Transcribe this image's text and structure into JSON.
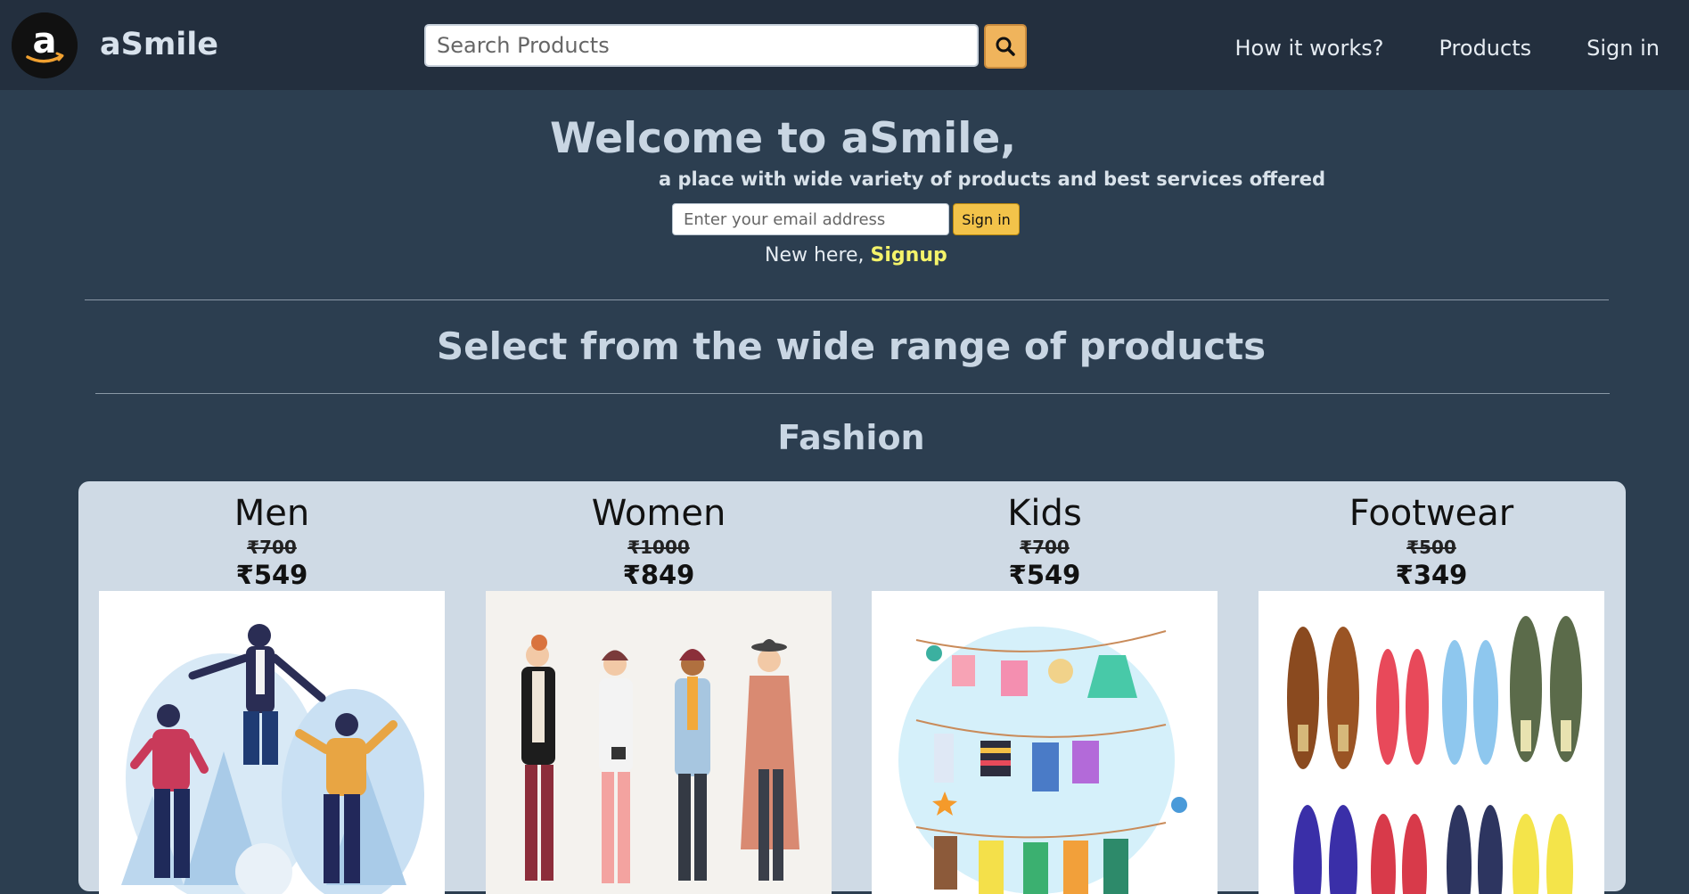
{
  "header": {
    "brand": "aSmile",
    "search": {
      "placeholder": "Search Products"
    },
    "nav": {
      "how_it_works": "How it works?",
      "products": "Products",
      "sign_in": "Sign in"
    }
  },
  "hero": {
    "title": "Welcome to aSmile,",
    "subtitle": "a place with wide variety of products and best services offered",
    "email_placeholder": "Enter your email address",
    "signin_label": "Sign in",
    "new_here": "New here, ",
    "signup_label": "Signup"
  },
  "section": {
    "title": "Select from the wide range of products",
    "category": "Fashion"
  },
  "products": [
    {
      "name": "Men",
      "old_price": "₹700",
      "price": "₹549",
      "image": "men-illustration"
    },
    {
      "name": "Women",
      "old_price": "₹1000",
      "price": "₹849",
      "image": "women-illustration"
    },
    {
      "name": "Kids",
      "old_price": "₹700",
      "price": "₹549",
      "image": "kids-clothesline-illustration"
    },
    {
      "name": "Footwear",
      "old_price": "₹500",
      "price": "₹349",
      "image": "shoes-illustration"
    }
  ],
  "colors": {
    "navbar": "#232f3e",
    "page_bg": "#2c3e50",
    "accent_orange": "#f0b45c",
    "signup_yellow": "#f4f36a",
    "panel_bg": "#cfdae5"
  }
}
